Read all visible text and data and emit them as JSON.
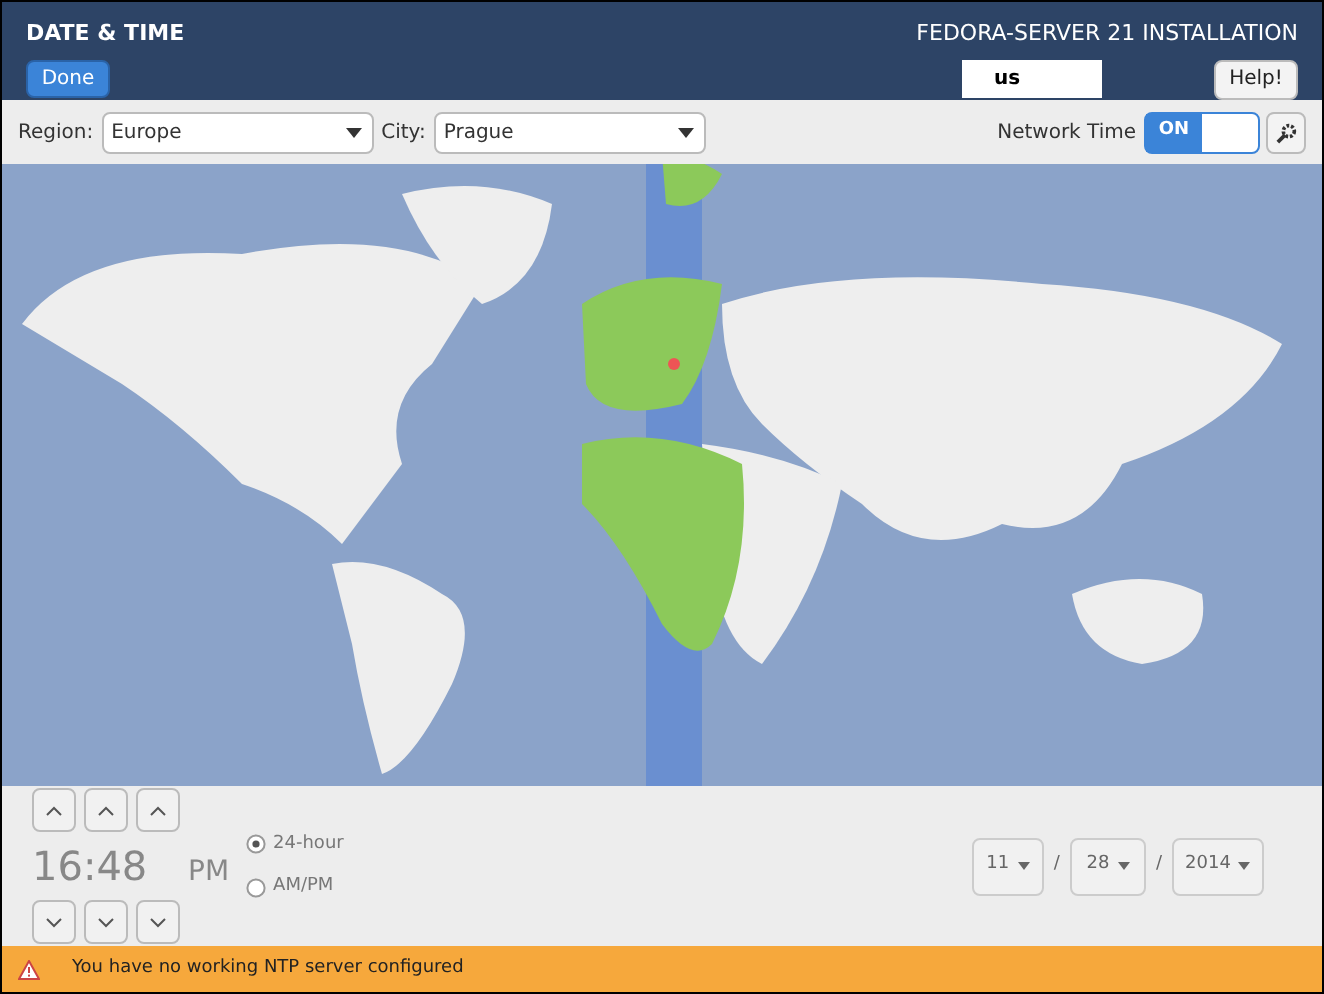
{
  "header": {
    "title": "DATE & TIME",
    "done_button": "Done",
    "product": "FEDORA-SERVER 21 INSTALLATION",
    "keyboard_layout": "us",
    "help_button": "Help!"
  },
  "toolbar": {
    "region_label": "Region:",
    "region": "Europe",
    "city_label": "City:",
    "city": "Prague",
    "network_time_label": "Network Time",
    "network_time": {
      "label": "ON",
      "on": true
    }
  },
  "time": {
    "clock": "16:48",
    "period": "PM",
    "formats": [
      {
        "label": "24-hour",
        "selected": true
      },
      {
        "label": "AM/PM",
        "selected": false
      }
    ]
  },
  "date": {
    "fields": [
      "11",
      "28",
      "2014"
    ],
    "separator": "/"
  },
  "warning": {
    "text": "You have no working NTP server configured"
  }
}
